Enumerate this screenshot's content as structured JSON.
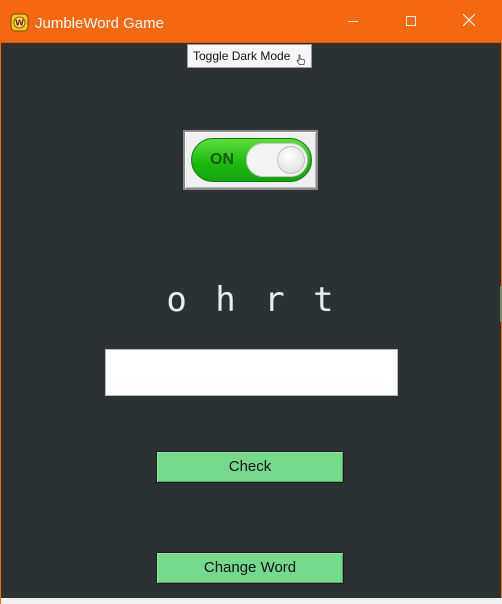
{
  "window": {
    "title": "JumbleWord Game",
    "titlebar_color": "#f56811",
    "background_color": "#2c3133",
    "icons": {
      "app": "jumble-app-icon",
      "minimize": "minimize-icon",
      "maximize": "maximize-icon",
      "close": "close-icon"
    }
  },
  "tooltip": {
    "text": "Toggle Dark Mode"
  },
  "toggle": {
    "label": "ON",
    "state": "on",
    "color": "#1dbb10"
  },
  "game": {
    "jumbled_word": "o h r t",
    "answer_value": "",
    "check_label": "Check",
    "change_label": "Change Word",
    "button_color": "#74d98a"
  }
}
